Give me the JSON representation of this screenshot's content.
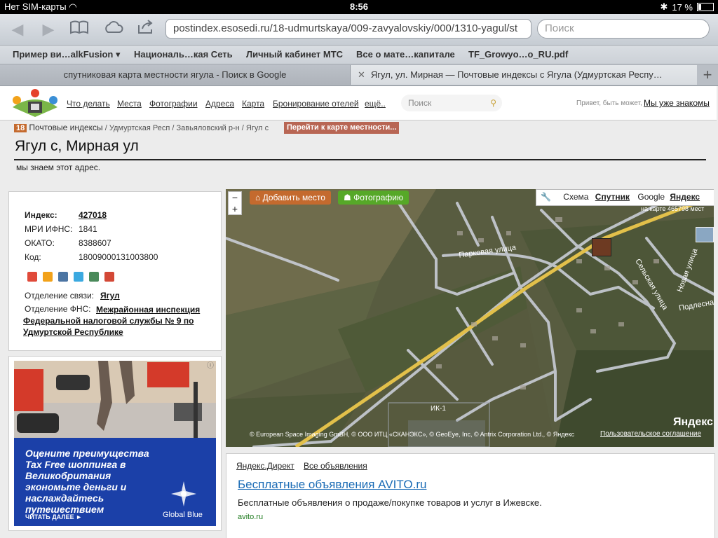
{
  "status": {
    "carrier": "Нет SIM-карты",
    "time": "8:56",
    "battery": "17 %"
  },
  "toolbar": {
    "url": "postindex.esosedi.ru/18-udmurtskaya/009-zavyalovskiy/000/1310-yagul/st",
    "search_placeholder": "Поиск"
  },
  "bookmarks": [
    "Пример ви…alkFusion ▾",
    "Националь…кая Сеть",
    "Личный кабинет МТС",
    "Все о мате…капитале",
    "TF_Growyo…o_RU.pdf"
  ],
  "tabs": [
    {
      "label": "спутниковая карта местности ягула - Поиск в Google"
    },
    {
      "label": "Ягул, ул. Мирная — Почтовые индексы с Ягула (Удмуртская Респу…"
    }
  ],
  "site_nav": {
    "links": [
      "Что делать",
      "Места",
      "Фотографии",
      "Адреса",
      "Карта",
      "Бронирование отелей",
      "ещё.."
    ],
    "search_placeholder": "Поиск",
    "greeting": "Привет, быть может,",
    "login_link": "Мы уже знакомы"
  },
  "breadcrumb": {
    "region_badge": "18",
    "items": [
      "Почтовые индексы",
      "Удмуртская Респ",
      "Завьяловский р-н",
      "Ягул с"
    ],
    "map_button": "Перейти к карте местности..."
  },
  "page_title": "Ягул с, Мирная ул",
  "subtitle": "мы знаем этот адрес.",
  "info": {
    "index_label": "Индекс:",
    "index_value": "427018",
    "ifns_label": "МРИ ИФНС:",
    "ifns_value": "1841",
    "okato_label": "ОКАТО:",
    "okato_value": "8388607",
    "code_label": "Код:",
    "code_value": "18009000131003800",
    "post_office_label": "Отделение связи:",
    "post_office_value": "Ягул",
    "fns_label": "Отделение ФНС:",
    "fns_value": "Межрайонная инспекция Федеральной налоговой службы № 9 по Удмуртской Республике"
  },
  "ad_banner": {
    "text": "Оцените преимущества Tax Free шоппинга в Великобритания экономьте деньги и наслаждайтесь путешествием",
    "cta": "ЧИТАТЬ ДАЛЕЕ ►",
    "brand": "Global Blue"
  },
  "map": {
    "add_place": "Добавить место",
    "photos": "Фотографию",
    "layers": [
      "Схема",
      "Спутник",
      "Google",
      "Яндекс"
    ],
    "scale_note": "на карте 465798 мест",
    "street_park": "Парковая улица",
    "street_selskaya": "Сельская улица",
    "street_novaya": "Новая улица",
    "street_podlesnaya": "Подлесна",
    "label_ik": "ИК-1",
    "copyright": "© European Space Imaging GmBH, © ООО ИТЦ «СКАНЭКС», © GeoEye, Inc, © Antrix Corporation Ltd., © Яндекс",
    "terms": "Пользовательское соглашение",
    "logo": "Яндекс"
  },
  "direct_ad": {
    "source": "Яндекс.Директ",
    "all_ads": "Все объявления",
    "title": "Бесплатные объявления AVITO.ru",
    "text": "Бесплатные объявления о продаже/покупке товаров и услуг в Ижевске.",
    "domain": "avito.ru"
  }
}
